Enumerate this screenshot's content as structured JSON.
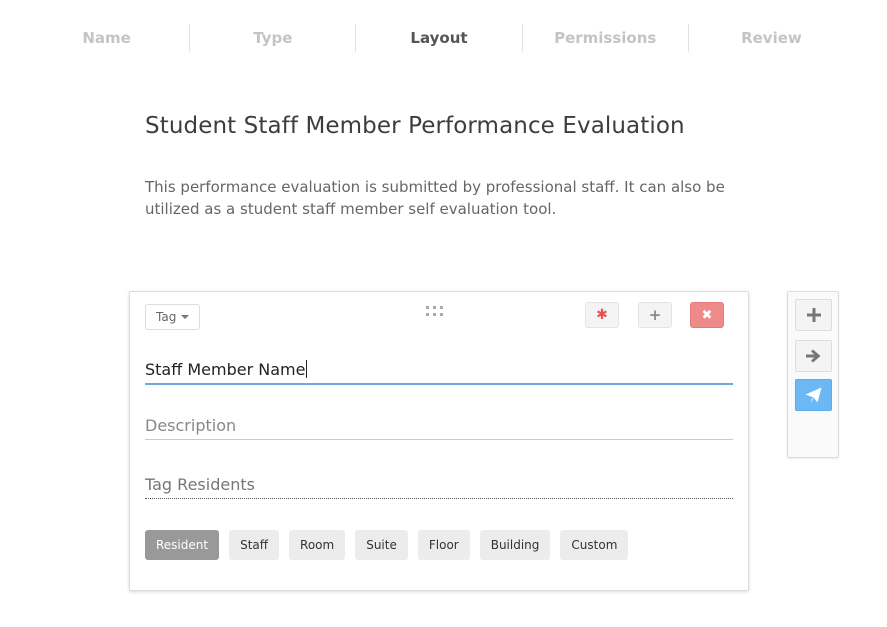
{
  "steps": [
    "Name",
    "Type",
    "Layout",
    "Permissions",
    "Review"
  ],
  "active_step": "Layout",
  "form": {
    "title": "Student Staff Member Performance Evaluation",
    "description": "This performance evaluation is submitted by professional staff. It can also be utilized as a student staff member self evaluation tool."
  },
  "question": {
    "tag_dropdown_label": "Tag",
    "name_value": "Staff Member Name",
    "description_placeholder": "Description",
    "tag_residents_placeholder": "Tag Residents",
    "tag_options": [
      "Resident",
      "Staff",
      "Room",
      "Suite",
      "Floor",
      "Building",
      "Custom"
    ],
    "selected_tag": "Resident"
  },
  "toolbar": {
    "required_icon": "asterisk-icon",
    "add_icon": "plus-icon",
    "delete_icon": "times-icon"
  },
  "side_toolbar": {
    "icons": [
      "plus-icon",
      "arrow-right-icon",
      "paper-plane-icon"
    ]
  },
  "colors": {
    "focus_underline": "#6ea6e0",
    "delete_button": "#ee8a8a",
    "required_asterisk": "#e35353",
    "send_button": "#6cb8f5",
    "selected_chip": "#999999"
  }
}
